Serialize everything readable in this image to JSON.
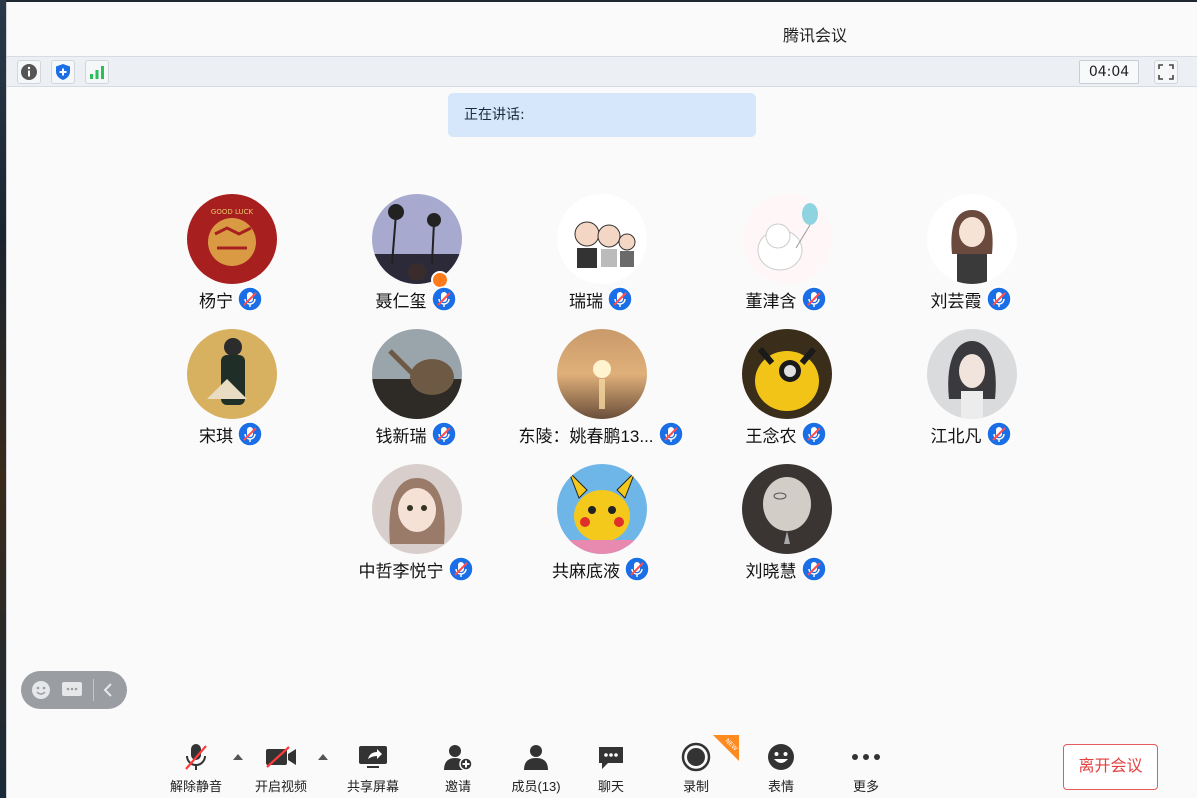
{
  "window": {
    "title": "腾讯会议"
  },
  "infobar": {
    "info_icon": "info-icon",
    "security_icon": "shield-icon",
    "network_icon": "signal-icon",
    "timer": "04:04",
    "fullscreen_icon": "fullscreen-icon"
  },
  "speaking": {
    "label": "正在讲话:"
  },
  "participants": [
    {
      "name": "杨宁"
    },
    {
      "name": "聂仁玺"
    },
    {
      "name": "瑞瑞"
    },
    {
      "name": "董津含"
    },
    {
      "name": "刘芸霞"
    },
    {
      "name": "宋琪"
    },
    {
      "name": "钱新瑞"
    },
    {
      "name": "东陵：姚春鹏13..."
    },
    {
      "name": "王念农"
    },
    {
      "name": "江北凡"
    },
    {
      "name": "中哲李悦宁"
    },
    {
      "name": "共麻底液"
    },
    {
      "name": "刘晓慧"
    }
  ],
  "toolbar": {
    "unmute": "解除静音",
    "video": "开启视频",
    "share": "共享屏幕",
    "invite": "邀请",
    "members": "成员(13)",
    "chat": "聊天",
    "record": "录制",
    "reactions": "表情",
    "more": "更多",
    "leave": "离开会议",
    "new_badge": "NEW"
  },
  "colors": {
    "accent": "#1a6fe6",
    "leave": "#e3403f",
    "host": "#ff7a1a"
  }
}
